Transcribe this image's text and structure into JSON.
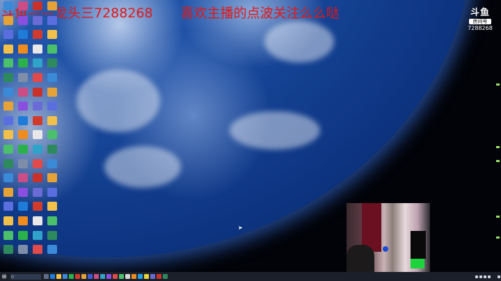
{
  "stream_title": {
    "left": "斗鱼——龙头三7288268",
    "right": "喜欢主播的点波关注么么哒"
  },
  "watermark": {
    "logo": "斗鱼",
    "badge": "房间号",
    "room_id": "7288268"
  },
  "desktop_icon_labels": [
    "",
    "",
    "",
    "",
    "",
    "",
    "",
    "",
    "",
    "",
    "",
    "",
    "",
    "",
    "",
    "",
    "",
    "",
    "",
    "",
    "",
    "",
    "",
    "",
    "",
    "",
    "",
    "",
    "",
    "",
    "",
    "",
    "",
    "",
    "",
    "",
    "",
    "",
    "",
    "",
    "",
    "",
    "",
    "",
    "",
    "",
    "",
    "",
    "",
    "",
    "",
    "",
    "",
    "",
    "",
    "",
    "",
    "",
    "",
    "",
    "",
    "",
    "",
    "",
    "",
    "",
    "",
    "",
    "",
    "",
    "",
    ""
  ],
  "taskbar": {
    "search_placeholder": "",
    "clock_time": "",
    "clock_date": ""
  },
  "colors": {
    "title_red": "#e01818",
    "taskbar": "#1b1f2a",
    "earth_blue": "#1b4da3"
  }
}
